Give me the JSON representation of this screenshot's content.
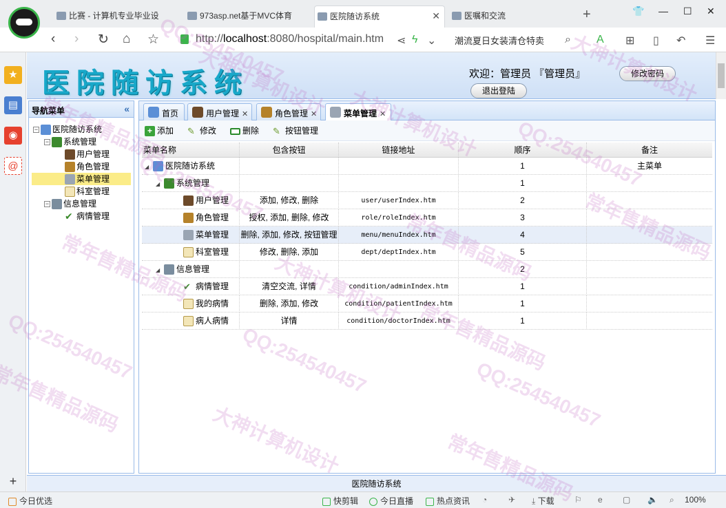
{
  "browser": {
    "tabs": [
      {
        "label": "比赛 - 计算机专业毕业设",
        "active": false
      },
      {
        "label": "973asp.net基于MVC体育",
        "active": false
      },
      {
        "label": "医院随访系统",
        "active": true
      },
      {
        "label": "医嘱和交流",
        "active": false
      }
    ],
    "url_prefix": "http://",
    "url_host": "localhost",
    "url_rest": ":8080/hospital/main.htm",
    "search_text": "潮流夏日女装清仓特卖",
    "status": {
      "left": "今日优选",
      "items": [
        "快剪辑",
        "今日直播",
        "热点资讯",
        "下载"
      ],
      "zoom": "100%"
    }
  },
  "app": {
    "logo_text": "医院随访系统",
    "welcome": "欢迎：管理员 『管理员』",
    "change_password": "修改密码",
    "logout": "退出登陆",
    "footer": "医院随访系统"
  },
  "nav": {
    "title": "导航菜单",
    "tree": [
      {
        "label": "医院随访系统",
        "icon": "home-icon"
      },
      {
        "label": "系统管理",
        "icon": "hash-icon"
      },
      {
        "label": "用户管理",
        "icon": "user-icon"
      },
      {
        "label": "角色管理",
        "icon": "role-icon"
      },
      {
        "label": "菜单管理",
        "icon": "menu-icon"
      },
      {
        "label": "科室管理",
        "icon": "doc-icon"
      },
      {
        "label": "信息管理",
        "icon": "search-user-icon"
      },
      {
        "label": "病情管理",
        "icon": "check-icon"
      }
    ]
  },
  "tabs": [
    {
      "label": "首页",
      "closable": false
    },
    {
      "label": "用户管理",
      "closable": true
    },
    {
      "label": "角色管理",
      "closable": true
    },
    {
      "label": "菜单管理",
      "closable": true
    }
  ],
  "toolbar": {
    "add": "添加",
    "edit": "修改",
    "delete": "删除",
    "buttons": "按钮管理"
  },
  "grid": {
    "columns": [
      "菜单名称",
      "包含按钮",
      "链接地址",
      "顺序",
      "备注"
    ],
    "rows": [
      {
        "name": "医院随访系统",
        "buttons": "",
        "url": "",
        "order": "1",
        "note": "主菜单"
      },
      {
        "name": "系统管理",
        "buttons": "",
        "url": "",
        "order": "1",
        "note": ""
      },
      {
        "name": "用户管理",
        "buttons": "添加, 修改, 删除",
        "url": "user/userIndex.htm",
        "order": "2",
        "note": ""
      },
      {
        "name": "角色管理",
        "buttons": "授权, 添加, 删除, 修改",
        "url": "role/roleIndex.htm",
        "order": "3",
        "note": ""
      },
      {
        "name": "菜单管理",
        "buttons": "删除, 添加, 修改, 按钮管理",
        "url": "menu/menuIndex.htm",
        "order": "4",
        "note": ""
      },
      {
        "name": "科室管理",
        "buttons": "修改, 删除, 添加",
        "url": "dept/deptIndex.htm",
        "order": "5",
        "note": ""
      },
      {
        "name": "信息管理",
        "buttons": "",
        "url": "",
        "order": "2",
        "note": ""
      },
      {
        "name": "病情管理",
        "buttons": "清空交流, 详情",
        "url": "condition/adminIndex.htm",
        "order": "1",
        "note": ""
      },
      {
        "name": "我的病情",
        "buttons": "删除, 添加, 修改",
        "url": "condition/patientIndex.htm",
        "order": "1",
        "note": ""
      },
      {
        "name": "病人病情",
        "buttons": "详情",
        "url": "condition/doctorIndex.htm",
        "order": "1",
        "note": ""
      }
    ]
  },
  "watermarks": [
    "QQ:254540457",
    "大神计算机设计",
    "常年售精品源码"
  ]
}
